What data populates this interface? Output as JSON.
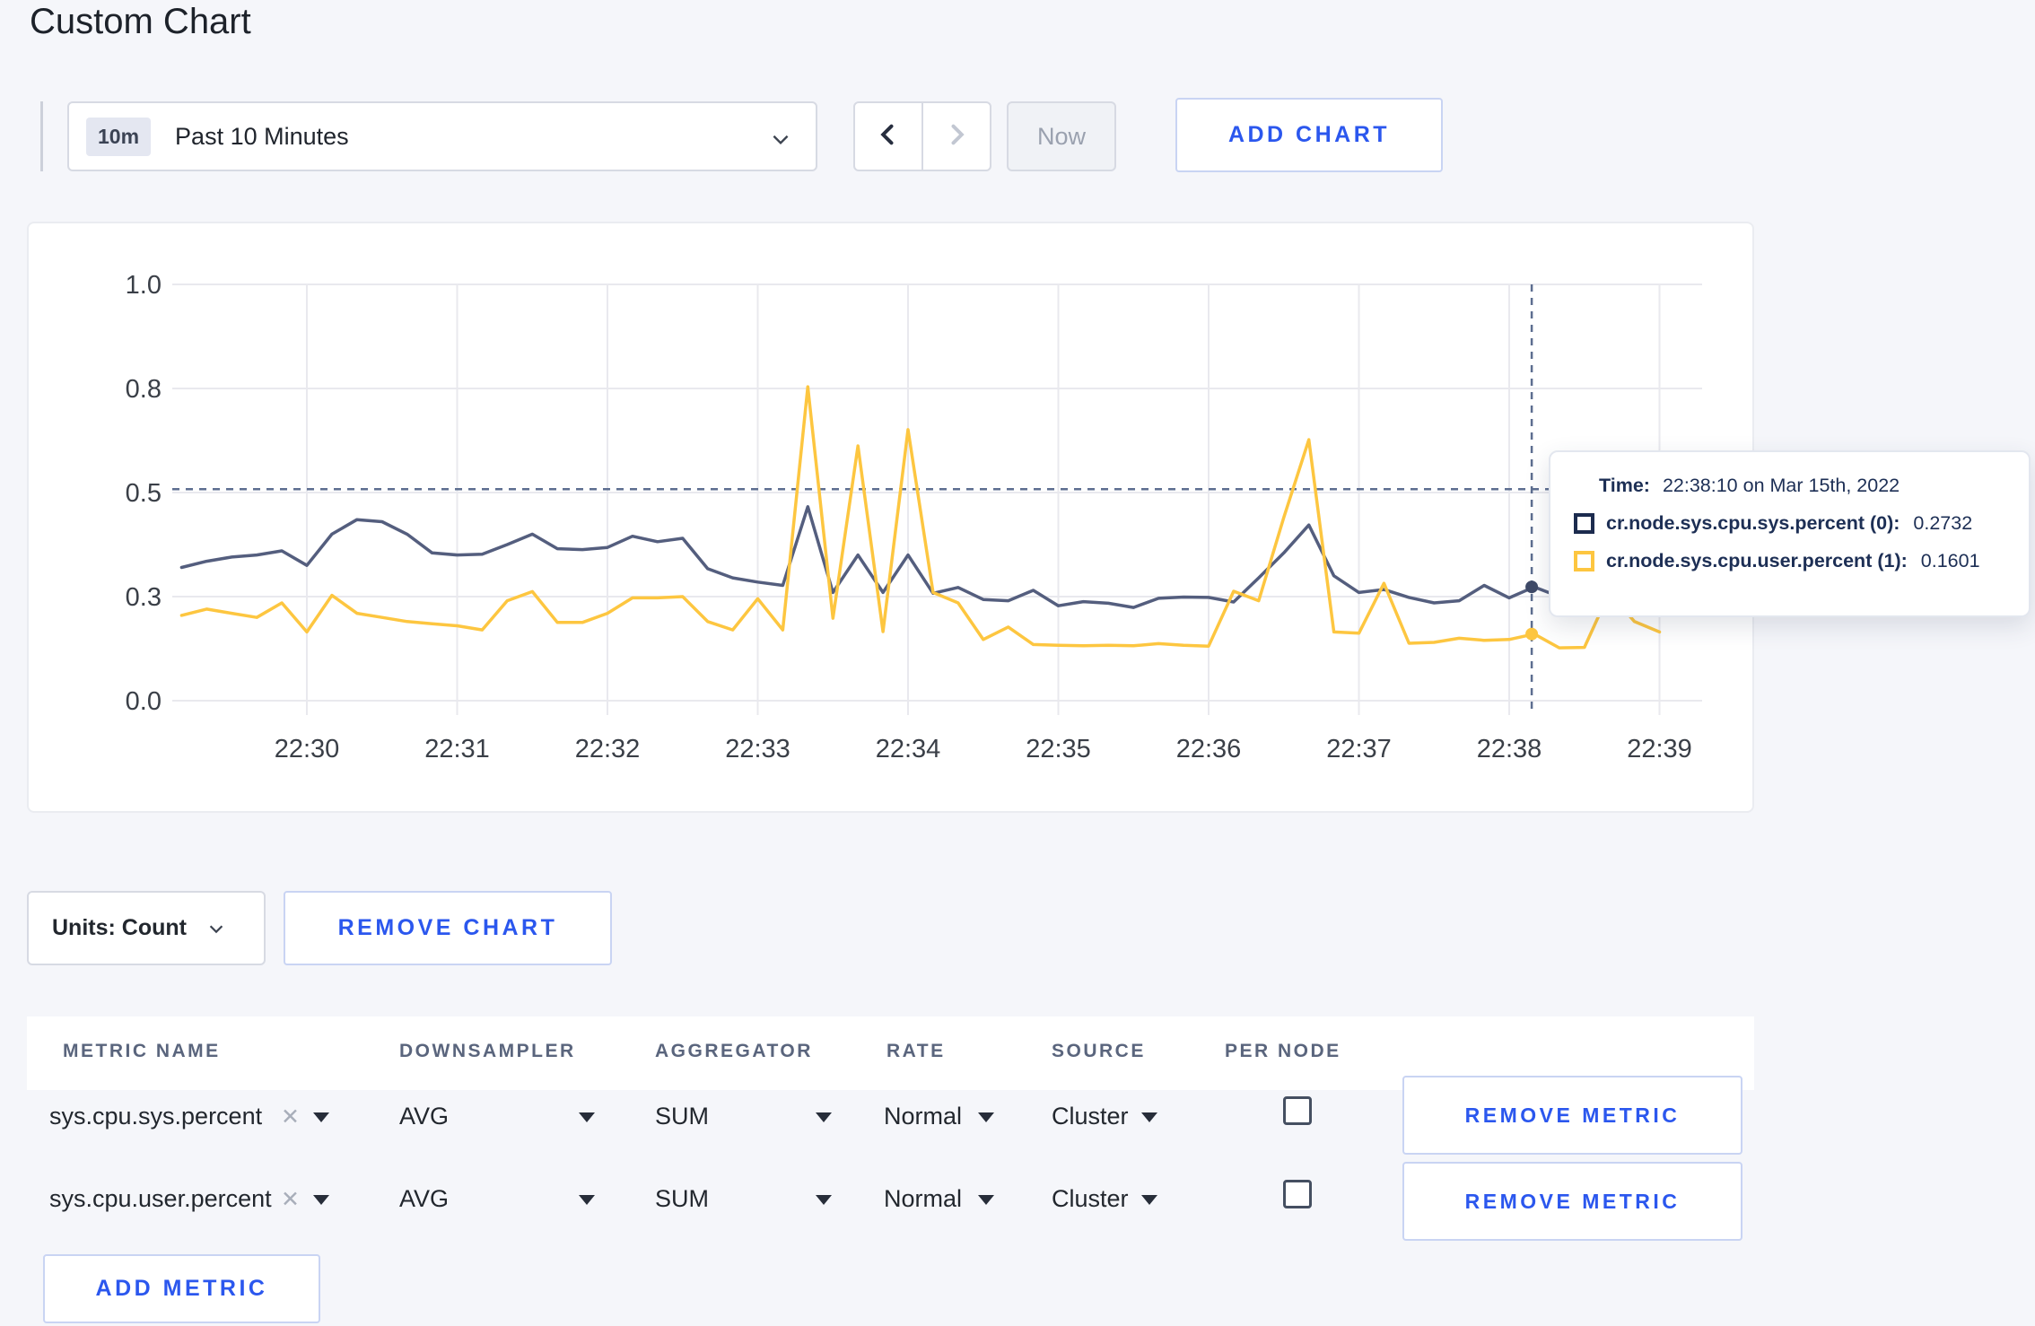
{
  "page": {
    "title": "Custom Chart"
  },
  "toolbar": {
    "range_badge": "10m",
    "range_label": "Past 10 Minutes",
    "now_label": "Now",
    "add_chart_label": "ADD CHART"
  },
  "chart_data": {
    "type": "line",
    "title": "",
    "xlabel": "",
    "ylabel": "",
    "x_unit": "seconds relative to 22:30:00, points every 10s",
    "ylim": [
      0,
      1
    ],
    "grid": true,
    "legend_position": "none",
    "yticks": [
      {
        "label": "0.0",
        "v": 0
      },
      {
        "label": "0.3",
        "v": 0.25
      },
      {
        "label": "0.5",
        "v": 0.5
      },
      {
        "label": "0.8",
        "v": 0.75
      },
      {
        "label": "1.0",
        "v": 1
      }
    ],
    "xticks": [
      {
        "label": "22:30",
        "t": 0
      },
      {
        "label": "22:31",
        "t": 60
      },
      {
        "label": "22:32",
        "t": 120
      },
      {
        "label": "22:33",
        "t": 180
      },
      {
        "label": "22:34",
        "t": 240
      },
      {
        "label": "22:35",
        "t": 300
      },
      {
        "label": "22:36",
        "t": 360
      },
      {
        "label": "22:37",
        "t": 420
      },
      {
        "label": "22:38",
        "t": 480
      },
      {
        "label": "22:39",
        "t": 540
      }
    ],
    "crosshair": {
      "t": 489,
      "v": 0.508
    },
    "series": [
      {
        "name": "cr.node.sys.cpu.sys.percent",
        "color": "#545E7E",
        "dot_color": "#3F4A68",
        "hover_value": 0.2732,
        "points": [
          [
            -50,
            0.32
          ],
          [
            -40,
            0.335
          ],
          [
            -30,
            0.345
          ],
          [
            -20,
            0.35
          ],
          [
            -10,
            0.36
          ],
          [
            0,
            0.325
          ],
          [
            10,
            0.4
          ],
          [
            20,
            0.435
          ],
          [
            30,
            0.43
          ],
          [
            40,
            0.4
          ],
          [
            50,
            0.355
          ],
          [
            60,
            0.35
          ],
          [
            70,
            0.352
          ],
          [
            80,
            0.375
          ],
          [
            90,
            0.4
          ],
          [
            100,
            0.365
          ],
          [
            110,
            0.363
          ],
          [
            120,
            0.368
          ],
          [
            130,
            0.395
          ],
          [
            140,
            0.382
          ],
          [
            150,
            0.39
          ],
          [
            160,
            0.317
          ],
          [
            170,
            0.295
          ],
          [
            180,
            0.285
          ],
          [
            190,
            0.277
          ],
          [
            200,
            0.466
          ],
          [
            210,
            0.26
          ],
          [
            220,
            0.35
          ],
          [
            230,
            0.26
          ],
          [
            240,
            0.35
          ],
          [
            250,
            0.258
          ],
          [
            260,
            0.272
          ],
          [
            270,
            0.243
          ],
          [
            280,
            0.24
          ],
          [
            290,
            0.265
          ],
          [
            300,
            0.228
          ],
          [
            310,
            0.238
          ],
          [
            320,
            0.234
          ],
          [
            330,
            0.224
          ],
          [
            340,
            0.246
          ],
          [
            350,
            0.249
          ],
          [
            360,
            0.248
          ],
          [
            370,
            0.237
          ],
          [
            380,
            0.295
          ],
          [
            390,
            0.355
          ],
          [
            400,
            0.422
          ],
          [
            410,
            0.3
          ],
          [
            420,
            0.26
          ],
          [
            430,
            0.267
          ],
          [
            440,
            0.248
          ],
          [
            450,
            0.235
          ],
          [
            460,
            0.24
          ],
          [
            470,
            0.277
          ],
          [
            480,
            0.247
          ],
          [
            490,
            0.2732
          ],
          [
            500,
            0.25
          ],
          [
            510,
            0.262
          ],
          [
            520,
            0.268
          ],
          [
            530,
            0.262
          ],
          [
            540,
            0.26
          ]
        ]
      },
      {
        "name": "cr.node.sys.cpu.user.percent",
        "color": "#FDC640",
        "dot_color": "#FDC640",
        "hover_value": 0.1601,
        "points": [
          [
            -50,
            0.205
          ],
          [
            -40,
            0.22
          ],
          [
            -30,
            0.21
          ],
          [
            -20,
            0.2
          ],
          [
            -10,
            0.235
          ],
          [
            0,
            0.165
          ],
          [
            10,
            0.253
          ],
          [
            20,
            0.21
          ],
          [
            30,
            0.2
          ],
          [
            40,
            0.19
          ],
          [
            50,
            0.185
          ],
          [
            60,
            0.18
          ],
          [
            70,
            0.17
          ],
          [
            80,
            0.24
          ],
          [
            90,
            0.262
          ],
          [
            100,
            0.188
          ],
          [
            110,
            0.188
          ],
          [
            120,
            0.21
          ],
          [
            130,
            0.247
          ],
          [
            140,
            0.247
          ],
          [
            150,
            0.25
          ],
          [
            160,
            0.19
          ],
          [
            170,
            0.17
          ],
          [
            180,
            0.245
          ],
          [
            190,
            0.17
          ],
          [
            200,
            0.754
          ],
          [
            210,
            0.198
          ],
          [
            220,
            0.612
          ],
          [
            230,
            0.166
          ],
          [
            240,
            0.651
          ],
          [
            250,
            0.26
          ],
          [
            260,
            0.235
          ],
          [
            270,
            0.147
          ],
          [
            280,
            0.177
          ],
          [
            290,
            0.135
          ],
          [
            300,
            0.133
          ],
          [
            310,
            0.132
          ],
          [
            320,
            0.133
          ],
          [
            330,
            0.132
          ],
          [
            340,
            0.137
          ],
          [
            350,
            0.133
          ],
          [
            360,
            0.131
          ],
          [
            370,
            0.263
          ],
          [
            380,
            0.24
          ],
          [
            390,
            0.44
          ],
          [
            400,
            0.627
          ],
          [
            410,
            0.165
          ],
          [
            420,
            0.162
          ],
          [
            430,
            0.282
          ],
          [
            440,
            0.138
          ],
          [
            450,
            0.14
          ],
          [
            460,
            0.15
          ],
          [
            470,
            0.145
          ],
          [
            480,
            0.147
          ],
          [
            490,
            0.1601
          ],
          [
            500,
            0.127
          ],
          [
            510,
            0.128
          ],
          [
            520,
            0.26
          ],
          [
            530,
            0.19
          ],
          [
            540,
            0.165
          ]
        ]
      }
    ]
  },
  "tooltip": {
    "time_label": "Time:",
    "time_value": "22:38:10 on Mar 15th, 2022",
    "rows": [
      {
        "label": "cr.node.sys.cpu.sys.percent (0):",
        "value": "0.2732",
        "color": "#1C2B4E"
      },
      {
        "label": "cr.node.sys.cpu.user.percent (1):",
        "value": "0.1601",
        "color": "#FDC640"
      }
    ]
  },
  "chart_footer": {
    "units_label": "Units: Count",
    "remove_chart_label": "REMOVE CHART"
  },
  "table": {
    "headers": [
      "METRIC NAME",
      "DOWNSAMPLER",
      "AGGREGATOR",
      "RATE",
      "SOURCE",
      "PER NODE"
    ],
    "remove_metric_label": "REMOVE METRIC",
    "add_metric_label": "ADD METRIC",
    "metrics": [
      {
        "name": "sys.cpu.sys.percent",
        "downsampler": "AVG",
        "aggregator": "SUM",
        "rate": "Normal",
        "source": "Cluster",
        "per_node_checked": false
      },
      {
        "name": "sys.cpu.user.percent",
        "downsampler": "AVG",
        "aggregator": "SUM",
        "rate": "Normal",
        "source": "Cluster",
        "per_node_checked": false
      }
    ]
  },
  "colors": {
    "accent_blue": "#2B57EE",
    "series_sys": "#545E7E",
    "series_user": "#FDC640",
    "crosshair": "#5D6E90",
    "page_background": "#F5F6FA"
  }
}
